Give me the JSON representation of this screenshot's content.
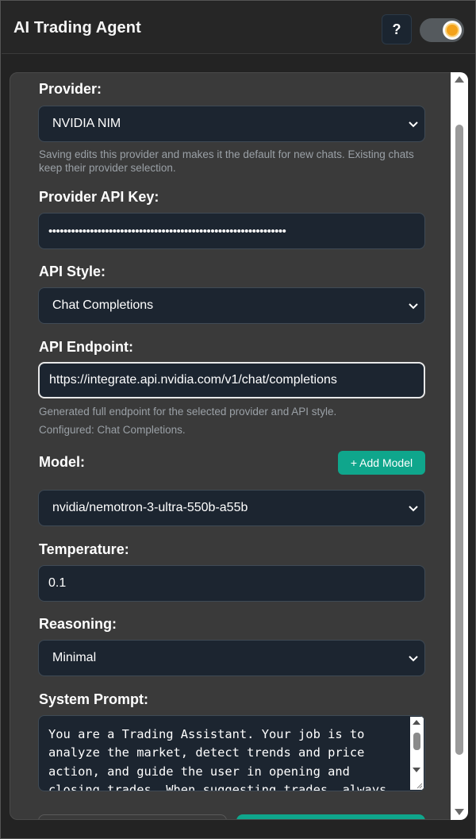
{
  "header": {
    "title": "AI Trading Agent",
    "help_label": "?"
  },
  "form": {
    "provider": {
      "label": "Provider:",
      "value": "NVIDIA NIM",
      "hint": "Saving edits this provider and makes it the default for new chats. Existing chats keep their provider selection."
    },
    "api_key": {
      "label": "Provider API Key:",
      "masked_value": "•••••••••••••••••••••••••••••••••••••••••••••••••••••••••••••••"
    },
    "api_style": {
      "label": "API Style:",
      "value": "Chat Completions"
    },
    "api_endpoint": {
      "label": "API Endpoint:",
      "value": "https://integrate.api.nvidia.com/v1/chat/completions",
      "hint": "Generated full endpoint for the selected provider and API style.",
      "configured": "Configured: Chat Completions."
    },
    "model": {
      "label": "Model:",
      "add_label": "+ Add Model",
      "value": "nvidia/nemotron-3-ultra-550b-a55b"
    },
    "temperature": {
      "label": "Temperature:",
      "value": "0.1"
    },
    "reasoning": {
      "label": "Reasoning:",
      "value": "Minimal"
    },
    "system_prompt": {
      "label": "System Prompt:",
      "value": "You are a Trading Assistant. Your job is to analyze the market, detect trends and price action, and guide the user in opening and closing trades. When suggesting trades, always"
    }
  },
  "colors": {
    "accent": "#0fa68c",
    "field_bg": "#1c2530",
    "panel_bg": "#3a3a3a",
    "sun": "#f4a21a"
  }
}
